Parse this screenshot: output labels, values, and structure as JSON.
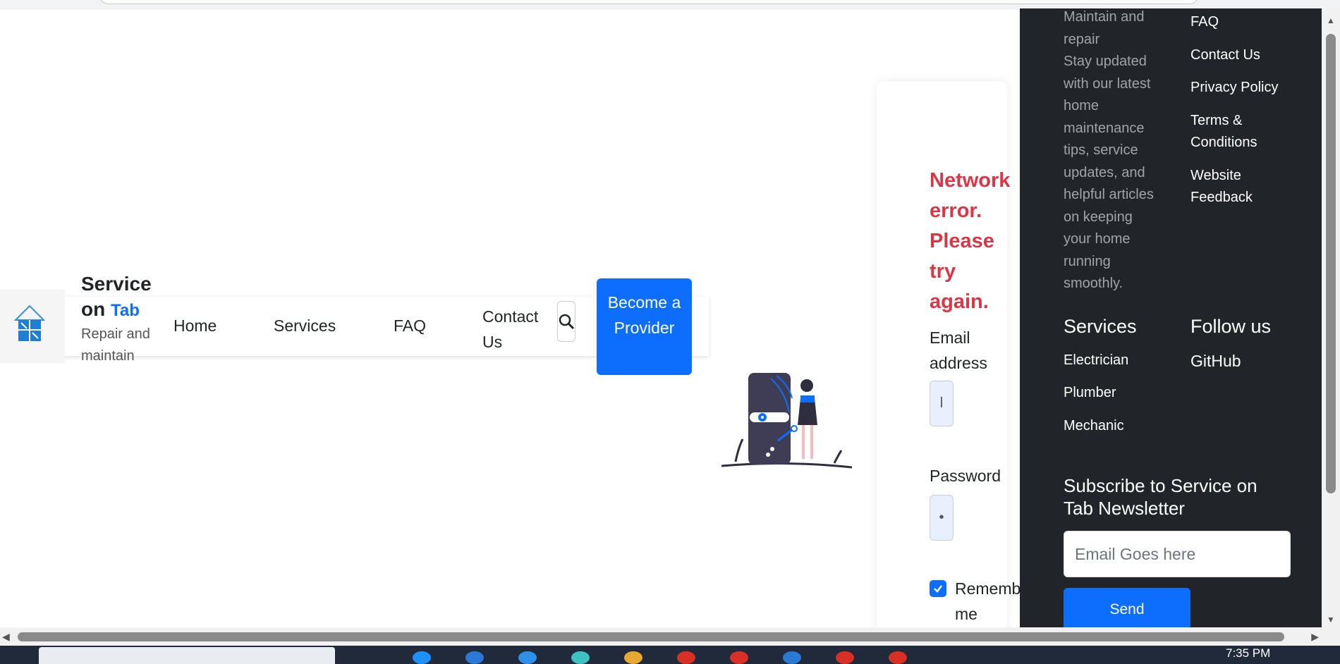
{
  "nav": {
    "brand_line1": "Service",
    "brand_on": "on",
    "brand_tab": "Tab",
    "tagline": "Repair and maintain",
    "links": [
      "Home",
      "Services",
      "FAQ",
      "Contact Us"
    ],
    "become_provider": "Become a Provider"
  },
  "login": {
    "error": "Network error. Please try again.",
    "email_label": "Email address",
    "email_value": "l",
    "password_label": "Password",
    "password_value": "•",
    "remember_label": "Remember me",
    "remember_checked": true
  },
  "footer": {
    "about_text": "Maintain and repair\nStay updated with our latest home maintenance tips, service updates, and helpful articles on keeping your home running smoothly.",
    "quick_links": [
      "FAQ",
      "Contact Us",
      "Privacy Policy",
      "Terms & Conditions",
      "Website Feedback"
    ],
    "services_heading": "Services",
    "services": [
      "Electrician",
      "Plumber",
      "Mechanic"
    ],
    "follow_heading": "Follow us",
    "follow_link": "GitHub",
    "newsletter_heading": "Subscribe to Service on Tab Newsletter",
    "newsletter_placeholder": "Email Goes here",
    "send_label": "Send"
  },
  "taskbar": {
    "time": "7:35 PM"
  },
  "colors": {
    "primary": "#0d6efd",
    "error": "#dc3545",
    "footer_bg": "#212529"
  }
}
